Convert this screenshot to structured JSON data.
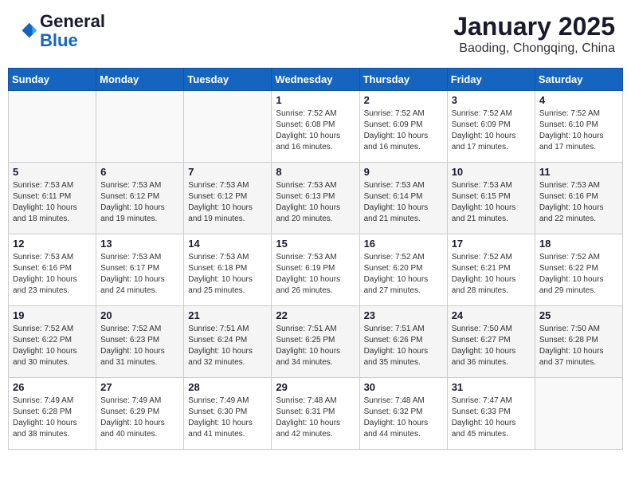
{
  "header": {
    "logo_line1": "General",
    "logo_line2": "Blue",
    "title": "January 2025",
    "subtitle": "Baoding, Chongqing, China"
  },
  "days_of_week": [
    "Sunday",
    "Monday",
    "Tuesday",
    "Wednesday",
    "Thursday",
    "Friday",
    "Saturday"
  ],
  "weeks": [
    [
      {
        "day": "",
        "info": ""
      },
      {
        "day": "",
        "info": ""
      },
      {
        "day": "",
        "info": ""
      },
      {
        "day": "1",
        "info": "Sunrise: 7:52 AM\nSunset: 6:08 PM\nDaylight: 10 hours and 16 minutes."
      },
      {
        "day": "2",
        "info": "Sunrise: 7:52 AM\nSunset: 6:09 PM\nDaylight: 10 hours and 16 minutes."
      },
      {
        "day": "3",
        "info": "Sunrise: 7:52 AM\nSunset: 6:09 PM\nDaylight: 10 hours and 17 minutes."
      },
      {
        "day": "4",
        "info": "Sunrise: 7:52 AM\nSunset: 6:10 PM\nDaylight: 10 hours and 17 minutes."
      }
    ],
    [
      {
        "day": "5",
        "info": "Sunrise: 7:53 AM\nSunset: 6:11 PM\nDaylight: 10 hours and 18 minutes."
      },
      {
        "day": "6",
        "info": "Sunrise: 7:53 AM\nSunset: 6:12 PM\nDaylight: 10 hours and 19 minutes."
      },
      {
        "day": "7",
        "info": "Sunrise: 7:53 AM\nSunset: 6:12 PM\nDaylight: 10 hours and 19 minutes."
      },
      {
        "day": "8",
        "info": "Sunrise: 7:53 AM\nSunset: 6:13 PM\nDaylight: 10 hours and 20 minutes."
      },
      {
        "day": "9",
        "info": "Sunrise: 7:53 AM\nSunset: 6:14 PM\nDaylight: 10 hours and 21 minutes."
      },
      {
        "day": "10",
        "info": "Sunrise: 7:53 AM\nSunset: 6:15 PM\nDaylight: 10 hours and 21 minutes."
      },
      {
        "day": "11",
        "info": "Sunrise: 7:53 AM\nSunset: 6:16 PM\nDaylight: 10 hours and 22 minutes."
      }
    ],
    [
      {
        "day": "12",
        "info": "Sunrise: 7:53 AM\nSunset: 6:16 PM\nDaylight: 10 hours and 23 minutes."
      },
      {
        "day": "13",
        "info": "Sunrise: 7:53 AM\nSunset: 6:17 PM\nDaylight: 10 hours and 24 minutes."
      },
      {
        "day": "14",
        "info": "Sunrise: 7:53 AM\nSunset: 6:18 PM\nDaylight: 10 hours and 25 minutes."
      },
      {
        "day": "15",
        "info": "Sunrise: 7:53 AM\nSunset: 6:19 PM\nDaylight: 10 hours and 26 minutes."
      },
      {
        "day": "16",
        "info": "Sunrise: 7:52 AM\nSunset: 6:20 PM\nDaylight: 10 hours and 27 minutes."
      },
      {
        "day": "17",
        "info": "Sunrise: 7:52 AM\nSunset: 6:21 PM\nDaylight: 10 hours and 28 minutes."
      },
      {
        "day": "18",
        "info": "Sunrise: 7:52 AM\nSunset: 6:22 PM\nDaylight: 10 hours and 29 minutes."
      }
    ],
    [
      {
        "day": "19",
        "info": "Sunrise: 7:52 AM\nSunset: 6:22 PM\nDaylight: 10 hours and 30 minutes."
      },
      {
        "day": "20",
        "info": "Sunrise: 7:52 AM\nSunset: 6:23 PM\nDaylight: 10 hours and 31 minutes."
      },
      {
        "day": "21",
        "info": "Sunrise: 7:51 AM\nSunset: 6:24 PM\nDaylight: 10 hours and 32 minutes."
      },
      {
        "day": "22",
        "info": "Sunrise: 7:51 AM\nSunset: 6:25 PM\nDaylight: 10 hours and 34 minutes."
      },
      {
        "day": "23",
        "info": "Sunrise: 7:51 AM\nSunset: 6:26 PM\nDaylight: 10 hours and 35 minutes."
      },
      {
        "day": "24",
        "info": "Sunrise: 7:50 AM\nSunset: 6:27 PM\nDaylight: 10 hours and 36 minutes."
      },
      {
        "day": "25",
        "info": "Sunrise: 7:50 AM\nSunset: 6:28 PM\nDaylight: 10 hours and 37 minutes."
      }
    ],
    [
      {
        "day": "26",
        "info": "Sunrise: 7:49 AM\nSunset: 6:28 PM\nDaylight: 10 hours and 38 minutes."
      },
      {
        "day": "27",
        "info": "Sunrise: 7:49 AM\nSunset: 6:29 PM\nDaylight: 10 hours and 40 minutes."
      },
      {
        "day": "28",
        "info": "Sunrise: 7:49 AM\nSunset: 6:30 PM\nDaylight: 10 hours and 41 minutes."
      },
      {
        "day": "29",
        "info": "Sunrise: 7:48 AM\nSunset: 6:31 PM\nDaylight: 10 hours and 42 minutes."
      },
      {
        "day": "30",
        "info": "Sunrise: 7:48 AM\nSunset: 6:32 PM\nDaylight: 10 hours and 44 minutes."
      },
      {
        "day": "31",
        "info": "Sunrise: 7:47 AM\nSunset: 6:33 PM\nDaylight: 10 hours and 45 minutes."
      },
      {
        "day": "",
        "info": ""
      }
    ]
  ]
}
